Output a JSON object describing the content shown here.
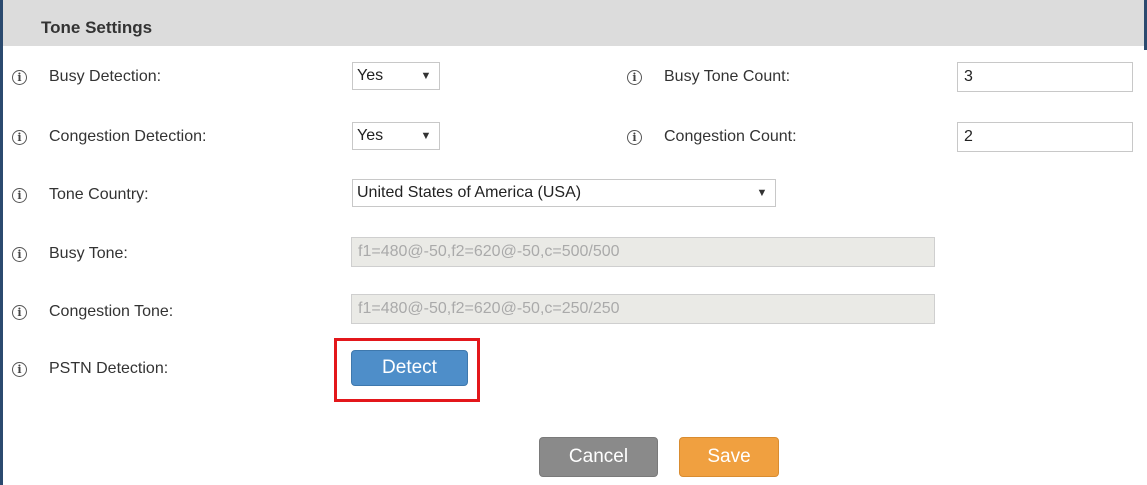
{
  "header": {
    "title": "Tone Settings"
  },
  "fields": {
    "busy_detection": {
      "label": "Busy Detection:",
      "value": "Yes"
    },
    "busy_tone_count": {
      "label": "Busy Tone Count:",
      "value": "3"
    },
    "congestion_detection": {
      "label": "Congestion Detection:",
      "value": "Yes"
    },
    "congestion_count": {
      "label": "Congestion Count:",
      "value": "2"
    },
    "tone_country": {
      "label": "Tone Country:",
      "value": "United States of America (USA)"
    },
    "busy_tone": {
      "label": "Busy Tone:",
      "value": "f1=480@-50,f2=620@-50,c=500/500"
    },
    "congestion_tone": {
      "label": "Congestion Tone:",
      "value": "f1=480@-50,f2=620@-50,c=250/250"
    },
    "pstn_detection": {
      "label": "PSTN Detection:"
    }
  },
  "buttons": {
    "detect": "Detect",
    "cancel": "Cancel",
    "save": "Save"
  },
  "icons": {
    "info": "info-icon",
    "dropdown": "dropdown-arrow-icon"
  },
  "colors": {
    "highlight": "#e3171b",
    "detect_button": "#4e8ec9",
    "save_button": "#f0a040",
    "cancel_button": "#8a8a8a"
  }
}
